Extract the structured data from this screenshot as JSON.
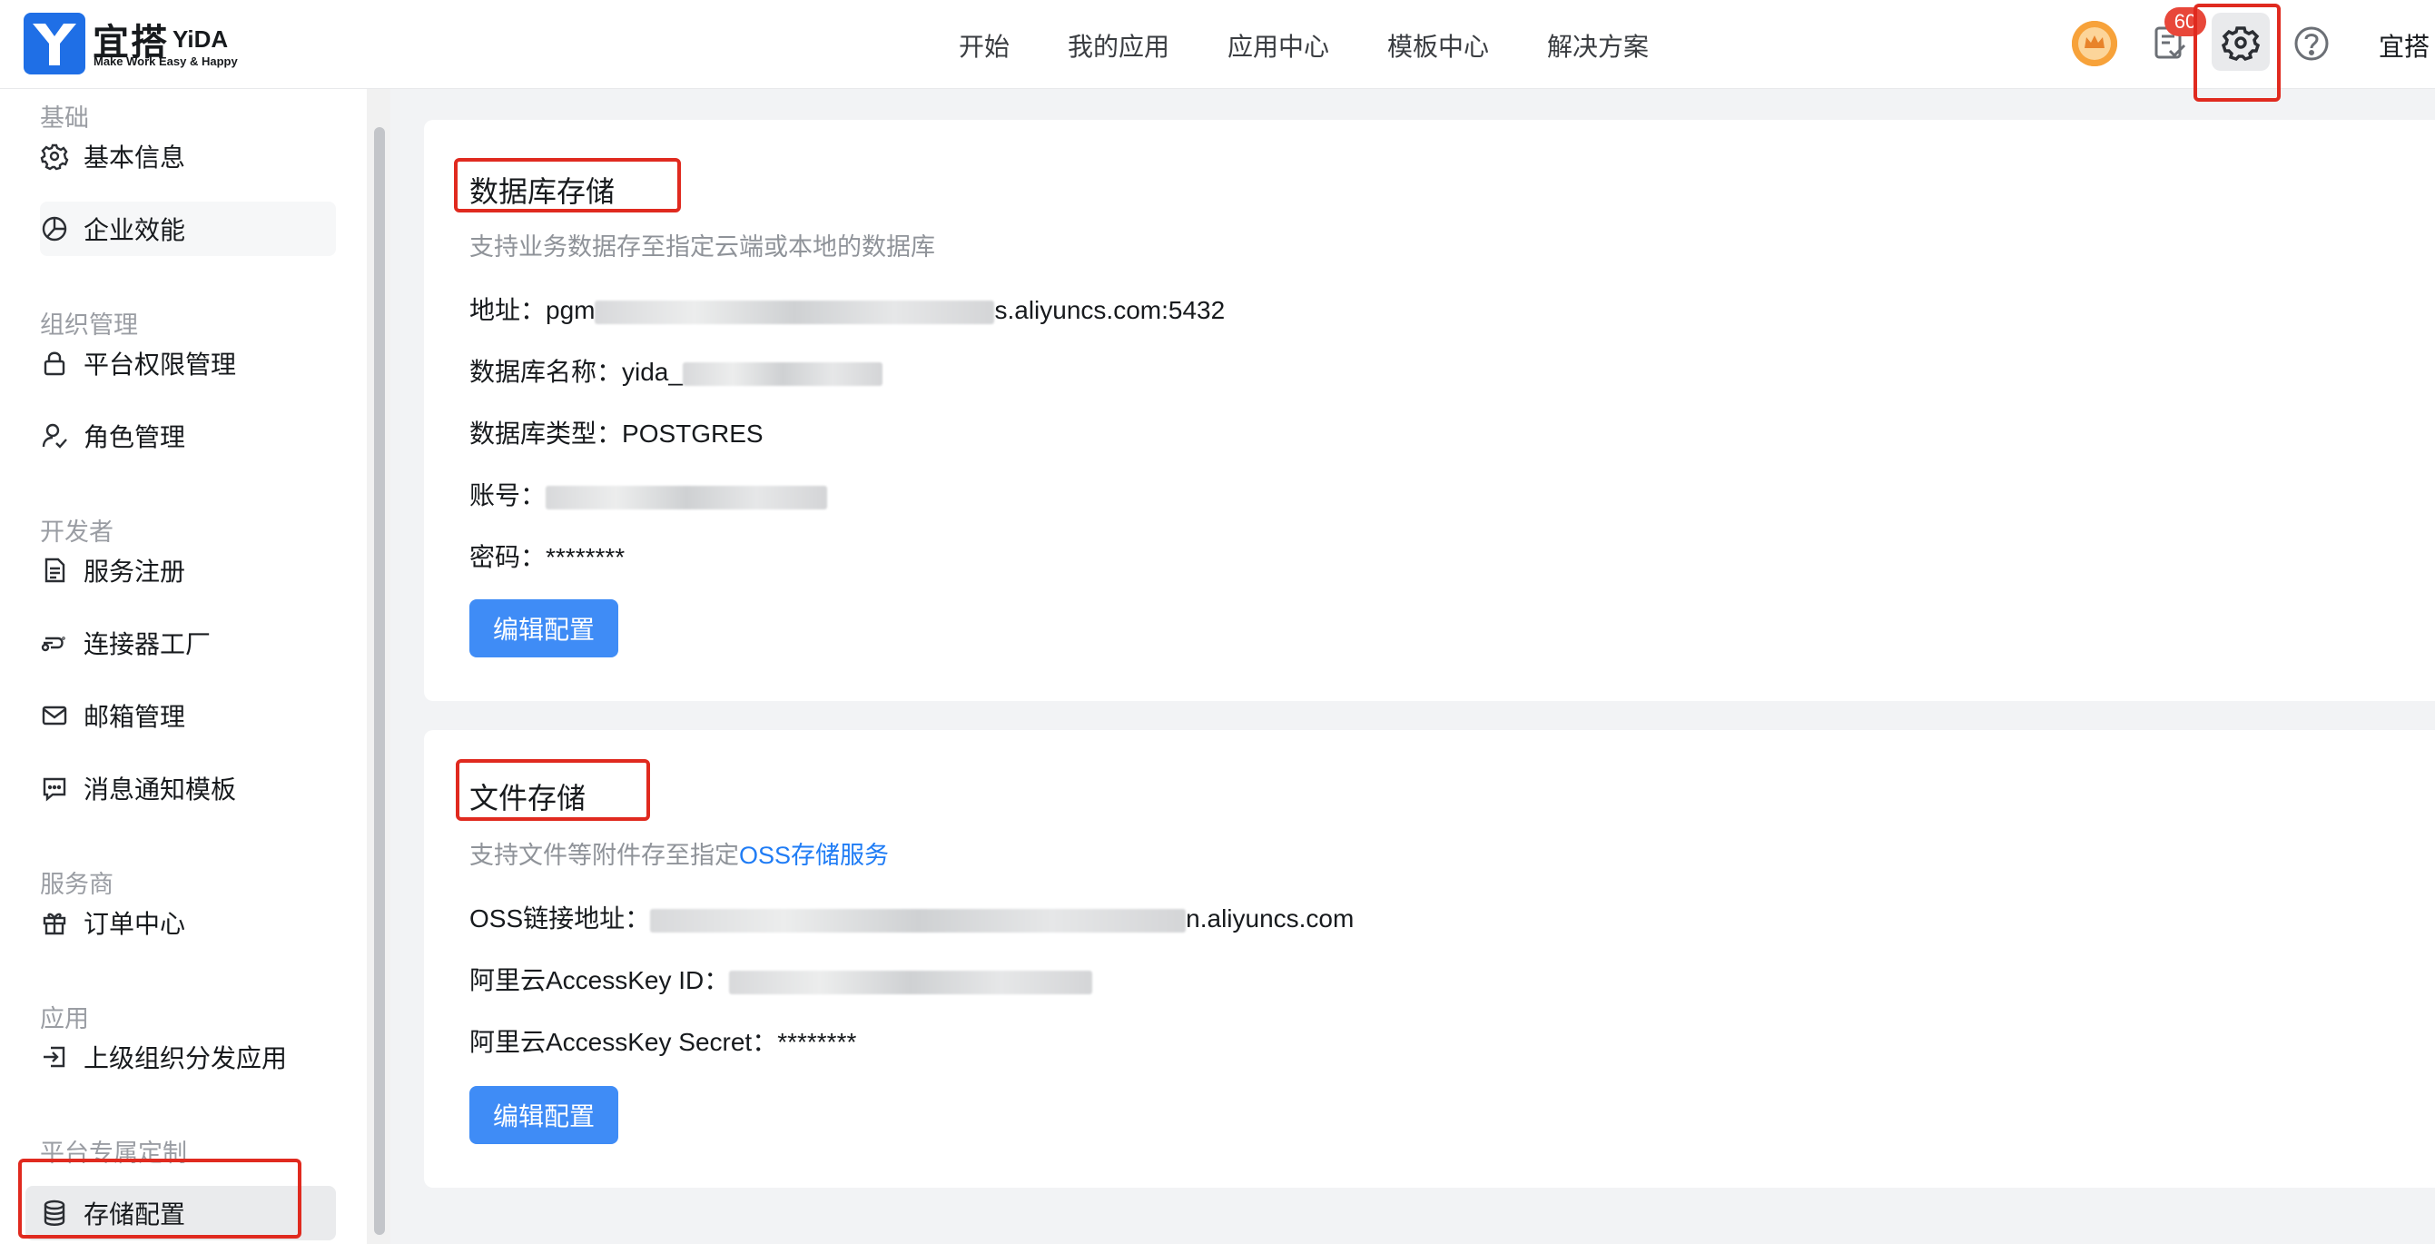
{
  "header": {
    "brand_cn": "宜搭",
    "brand_en": "YiDA",
    "slogan": "Make Work Easy & Happy",
    "nav": [
      "开始",
      "我的应用",
      "应用中心",
      "模板中心",
      "解决方案"
    ],
    "task_badge": "60",
    "user_name": "宜搭"
  },
  "sidebar": {
    "sections": [
      {
        "title": "基础",
        "items": [
          {
            "label": "基本信息",
            "icon": "gear-icon"
          },
          {
            "label": "企业效能",
            "icon": "pie-chart-icon"
          }
        ]
      },
      {
        "title": "组织管理",
        "items": [
          {
            "label": "平台权限管理",
            "icon": "lock-icon"
          },
          {
            "label": "角色管理",
            "icon": "user-role-icon"
          }
        ]
      },
      {
        "title": "开发者",
        "items": [
          {
            "label": "服务注册",
            "icon": "document-icon"
          },
          {
            "label": "连接器工厂",
            "icon": "connector-icon"
          },
          {
            "label": "邮箱管理",
            "icon": "mail-icon"
          },
          {
            "label": "消息通知模板",
            "icon": "message-icon"
          }
        ]
      },
      {
        "title": "服务商",
        "items": [
          {
            "label": "订单中心",
            "icon": "gift-icon"
          }
        ]
      },
      {
        "title": "应用",
        "items": [
          {
            "label": "上级组织分发应用",
            "icon": "import-icon"
          }
        ]
      },
      {
        "title": "平台专属定制",
        "items": [
          {
            "label": "存储配置",
            "icon": "database-icon"
          }
        ]
      }
    ]
  },
  "database_card": {
    "title": "数据库存储",
    "desc": "支持业务数据存至指定云端或本地的数据库",
    "address_label": "地址：",
    "address_prefix": "pgm",
    "address_suffix": "s.aliyuncs.com:5432",
    "dbname_label": "数据库名称：",
    "dbname_prefix": "yida_",
    "dbtype_label": "数据库类型：",
    "dbtype_value": "POSTGRES",
    "account_label": "账号：",
    "password_label": "密码：",
    "password_value": "********",
    "edit_button": "编辑配置"
  },
  "file_card": {
    "title": "文件存储",
    "desc_prefix": "支持文件等附件存至指定",
    "desc_link": "OSS存储服务",
    "oss_label": "OSS链接地址：",
    "oss_suffix": "n.aliyuncs.com",
    "ak_id_label": "阿里云AccessKey ID：",
    "ak_secret_label": "阿里云AccessKey Secret：",
    "ak_secret_value": "********",
    "edit_button": "编辑配置"
  },
  "colors": {
    "primary": "#3f8cf6",
    "link": "#1f7cf5",
    "annotation_red": "#e02a1f",
    "badge_red": "#e8473a",
    "crown_orange": "#f7a23a"
  }
}
